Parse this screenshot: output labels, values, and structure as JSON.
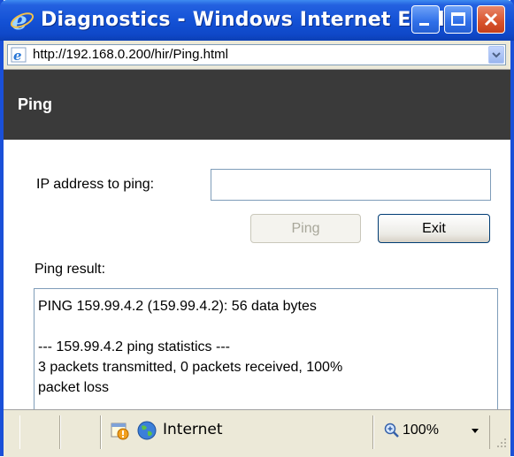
{
  "window": {
    "title": "Diagnostics - Windows Internet Expl...",
    "colors": {
      "titlebar": "#1452d6",
      "close": "#d8532c"
    }
  },
  "addressbar": {
    "url": "http://192.168.0.200/hir/Ping.html"
  },
  "page": {
    "heading": "Ping",
    "ip_label": "IP address to ping:",
    "ip_value": "",
    "ping_button": "Ping",
    "exit_button": "Exit",
    "result_label": "Ping result:",
    "result_lines": [
      "PING 159.99.4.2 (159.99.4.2): 56 data bytes",
      "",
      "--- 159.99.4.2 ping statistics ---",
      "3 packets transmitted, 0 packets received, 100%",
      "packet loss"
    ]
  },
  "statusbar": {
    "zone": "Internet",
    "zoom": "100%",
    "icons": [
      "security-warning-icon",
      "globe-icon",
      "zoom-icon"
    ]
  }
}
